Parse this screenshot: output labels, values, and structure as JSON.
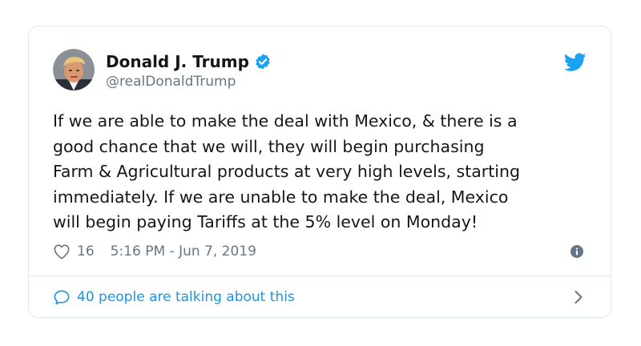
{
  "tweet": {
    "display_name": "Donald J. Trump",
    "handle": "@realDonaldTrump",
    "verified": true,
    "text": "If we are able to make the deal with Mexico, & there is a\ngood chance that we will, they will begin purchasing\nFarm & Agricultural products at very high levels, starting\nimmediately. If we are unable to make the deal, Mexico\nwill begin paying Tariffs at the 5% level on Monday!",
    "like_count": "16",
    "timestamp": "5:16 PM - Jun 7, 2019",
    "talking_label": "40 people are talking about this"
  },
  "icons": {
    "brand": "twitter-bird-icon",
    "verified": "verified-badge-icon",
    "like": "heart-icon",
    "info": "info-icon",
    "talking": "comment-bubble-icon",
    "more": "chevron-right-icon"
  },
  "colors": {
    "brand_blue": "#1da1f2",
    "link_blue": "#1b95e0",
    "text": "#14171a",
    "muted": "#657786",
    "border": "#e1e8ed"
  }
}
